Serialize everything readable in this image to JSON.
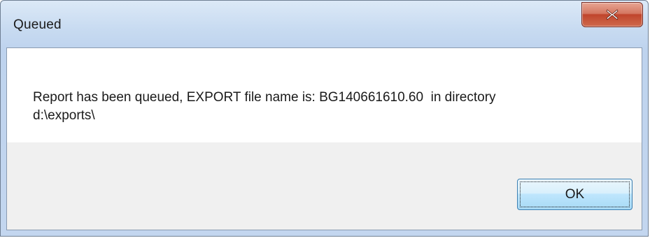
{
  "window": {
    "title": "Queued",
    "close_icon": "close-icon"
  },
  "dialog": {
    "message_line1": "Report has been queued, EXPORT file name is: BG140661610.60  in directory",
    "message_line2": "d:\\exports\\",
    "ok_label": "OK"
  },
  "colors": {
    "close_button": "#c7513a",
    "ok_border": "#3c7fb1",
    "footer_bg": "#f0f0f0"
  }
}
